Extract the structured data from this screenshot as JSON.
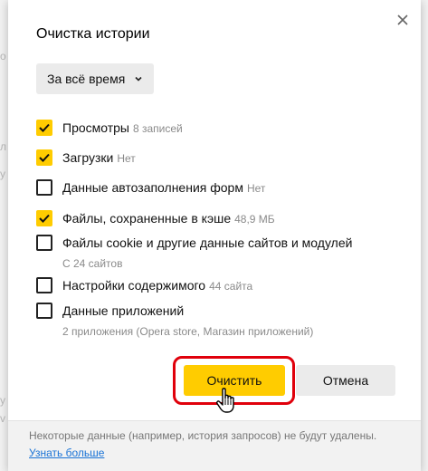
{
  "background_fragments": [
    "о",
    "л",
    "у",
    "у",
    "v"
  ],
  "dialog": {
    "title": "Очистка истории",
    "close_icon": "close-icon",
    "period": {
      "selected": "За всё время",
      "icon": "chevron-down-icon"
    },
    "options": [
      {
        "label": "Просмотры",
        "meta": "8 записей",
        "sub": "",
        "checked": true
      },
      {
        "label": "Загрузки",
        "meta": "Нет",
        "sub": "",
        "checked": true
      },
      {
        "label": "Данные автозаполнения форм",
        "meta": "Нет",
        "sub": "",
        "checked": false
      },
      {
        "label": "Файлы, сохраненные в кэше",
        "meta": "48,9 МБ",
        "sub": "",
        "checked": true
      },
      {
        "label": "Файлы cookie и другие данные сайтов и модулей",
        "meta": "",
        "sub": "С 24 сайтов",
        "checked": false
      },
      {
        "label": "Настройки содержимого",
        "meta": "44 сайта",
        "sub": "",
        "checked": false
      },
      {
        "label": "Данные приложений",
        "meta": "",
        "sub": "2 приложения (Opera store, Магазин приложений)",
        "checked": false
      }
    ],
    "buttons": {
      "clear": "Очистить",
      "cancel": "Отмена"
    },
    "footer": {
      "note": "Некоторые данные (например, история запросов) не будут удалены.",
      "link": "Узнать больше"
    },
    "colors": {
      "accent": "#ffcc00",
      "highlight": "#e0000b",
      "link": "#1a73d6"
    }
  }
}
